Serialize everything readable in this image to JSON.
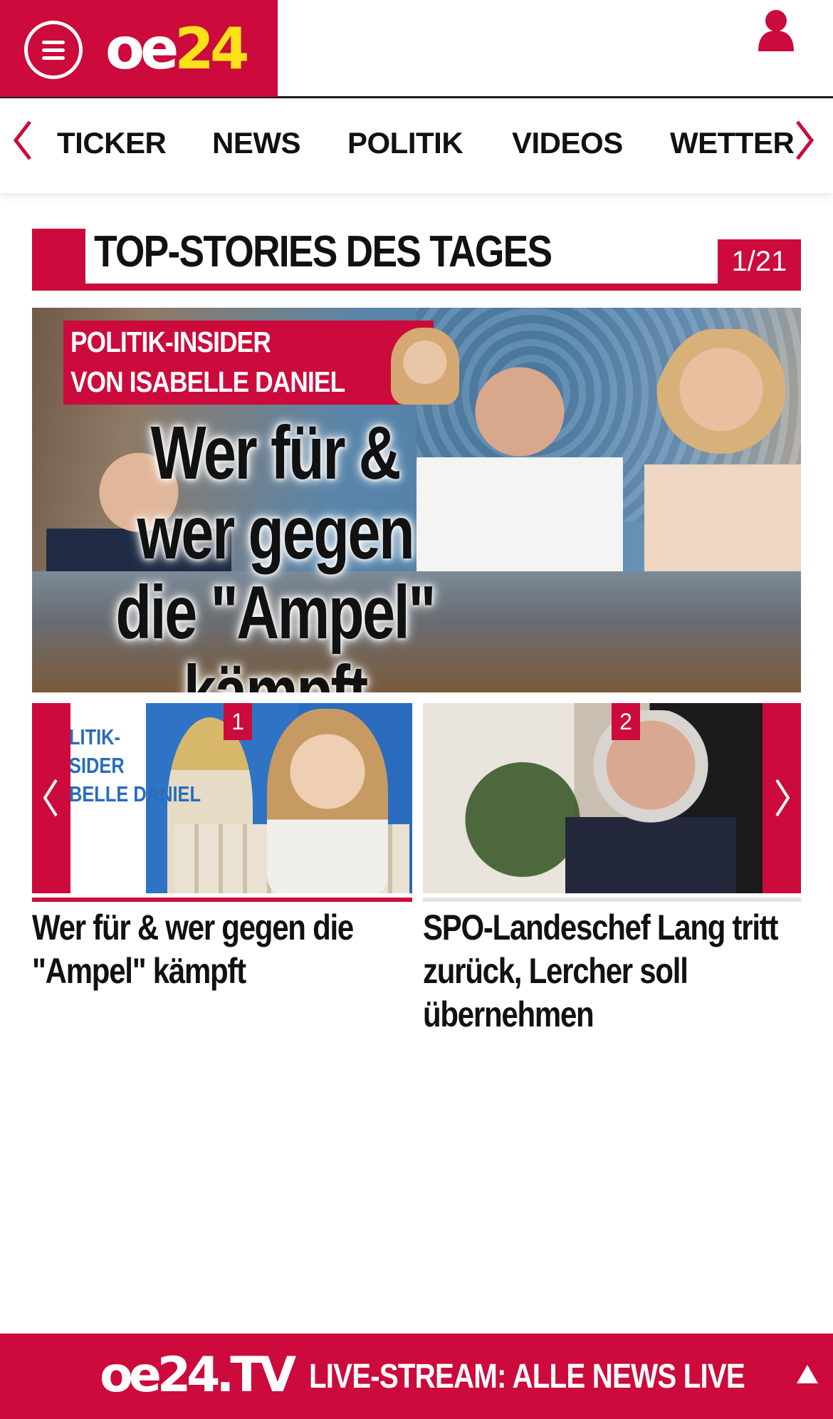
{
  "header": {
    "logo_oe": "oe",
    "logo_num": "24",
    "brand_color": "#cc0a3c",
    "logo_accent": "#ffe11a",
    "menu_icon": "hamburger-menu-icon",
    "user_icon": "user-icon"
  },
  "nav": {
    "items": [
      "TICKER",
      "NEWS",
      "POLITIK",
      "VIDEOS",
      "WETTER"
    ],
    "left_icon": "chevron-left-icon",
    "right_icon": "chevron-right-icon"
  },
  "section": {
    "title": "TOP-STORIES DES TAGES",
    "counter": "1/21"
  },
  "hero": {
    "kicker_line1": "POLITIK-INSIDER",
    "kicker_line2": "VON ISABELLE DANIEL",
    "headline": "Wer für &\nwer gegen\ndie \"Ampel\" kämpft"
  },
  "carousel": {
    "cards": [
      {
        "number": "1",
        "image_text": "LITIK-\nSIDER\nBELLE DANIEL",
        "title": "Wer für & wer gegen die \"Ampel\" kämpft",
        "active": true
      },
      {
        "number": "2",
        "title": "SPO-Landeschef Lang tritt zurück, Lercher soll übernehmen",
        "active": false
      }
    ]
  },
  "livebar": {
    "logo": "oe24.TV",
    "text": "LIVE-STREAM:  ALLE NEWS LIVE",
    "icon": "scroll-up-arrow-icon"
  }
}
